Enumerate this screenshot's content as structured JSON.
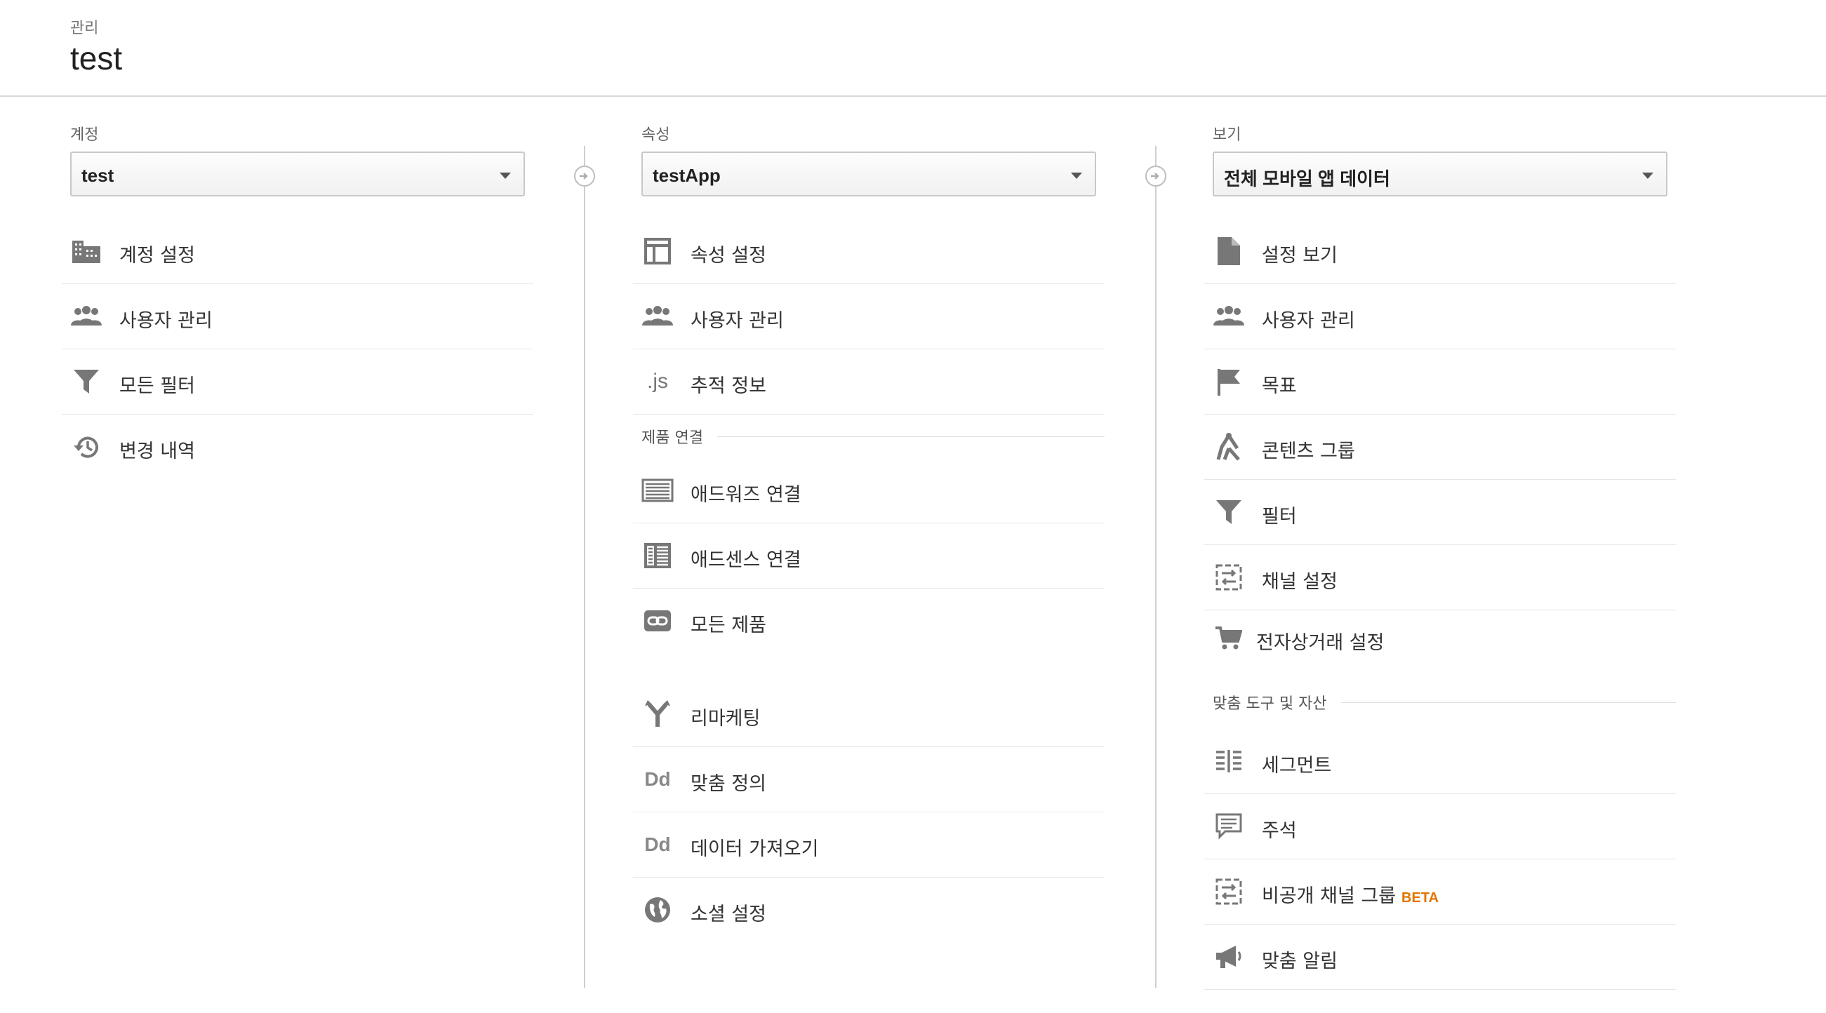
{
  "header": {
    "breadcrumb": "관리",
    "title": "test"
  },
  "account": {
    "label": "계정",
    "selected": "test",
    "items": [
      {
        "label": "계정 설정",
        "icon": "building-icon"
      },
      {
        "label": "사용자 관리",
        "icon": "users-icon"
      },
      {
        "label": "모든 필터",
        "icon": "filter-icon"
      },
      {
        "label": "변경 내역",
        "icon": "history-icon"
      }
    ]
  },
  "property": {
    "label": "속성",
    "selected": "testApp",
    "items": [
      {
        "label": "속성 설정",
        "icon": "layout-icon"
      },
      {
        "label": "사용자 관리",
        "icon": "users-icon"
      },
      {
        "label": "추적 정보",
        "icon": "js-icon"
      }
    ],
    "product_section": "제품 연결",
    "product_items": [
      {
        "label": "애드워즈 연결",
        "icon": "adwords-icon"
      },
      {
        "label": "애드센스 연결",
        "icon": "adsense-icon"
      },
      {
        "label": "모든 제품",
        "icon": "link-icon"
      }
    ],
    "more_items": [
      {
        "label": "리마케팅",
        "icon": "remarketing-icon"
      },
      {
        "label": "맞춤 정의",
        "icon": "dd-icon",
        "icon_text": "Dd"
      },
      {
        "label": "데이터 가져오기",
        "icon": "dd-icon",
        "icon_text": "Dd"
      },
      {
        "label": "소셜 설정",
        "icon": "globe-icon"
      }
    ]
  },
  "view": {
    "label": "보기",
    "selected": "전체 모바일 앱 데이터",
    "items": [
      {
        "label": "설정 보기",
        "icon": "document-icon"
      },
      {
        "label": "사용자 관리",
        "icon": "users-icon"
      },
      {
        "label": "목표",
        "icon": "flag-icon"
      },
      {
        "label": "콘텐츠 그룹",
        "icon": "content-group-icon"
      },
      {
        "label": "필터",
        "icon": "filter-icon"
      },
      {
        "label": "채널 설정",
        "icon": "channel-icon"
      },
      {
        "label": "전자상거래 설정",
        "icon": "cart-icon"
      }
    ],
    "tools_section": "맞춤 도구 및 자산",
    "tools_items": [
      {
        "label": "세그먼트",
        "icon": "segment-icon"
      },
      {
        "label": "주석",
        "icon": "comment-icon"
      },
      {
        "label": "비공개 채널 그룹",
        "icon": "channel-icon",
        "badge": "BETA"
      },
      {
        "label": "맞춤 알림",
        "icon": "megaphone-icon"
      }
    ]
  },
  "colors": {
    "icon": "#777777",
    "beta": "#e37400",
    "divider": "#e6e6e6"
  }
}
